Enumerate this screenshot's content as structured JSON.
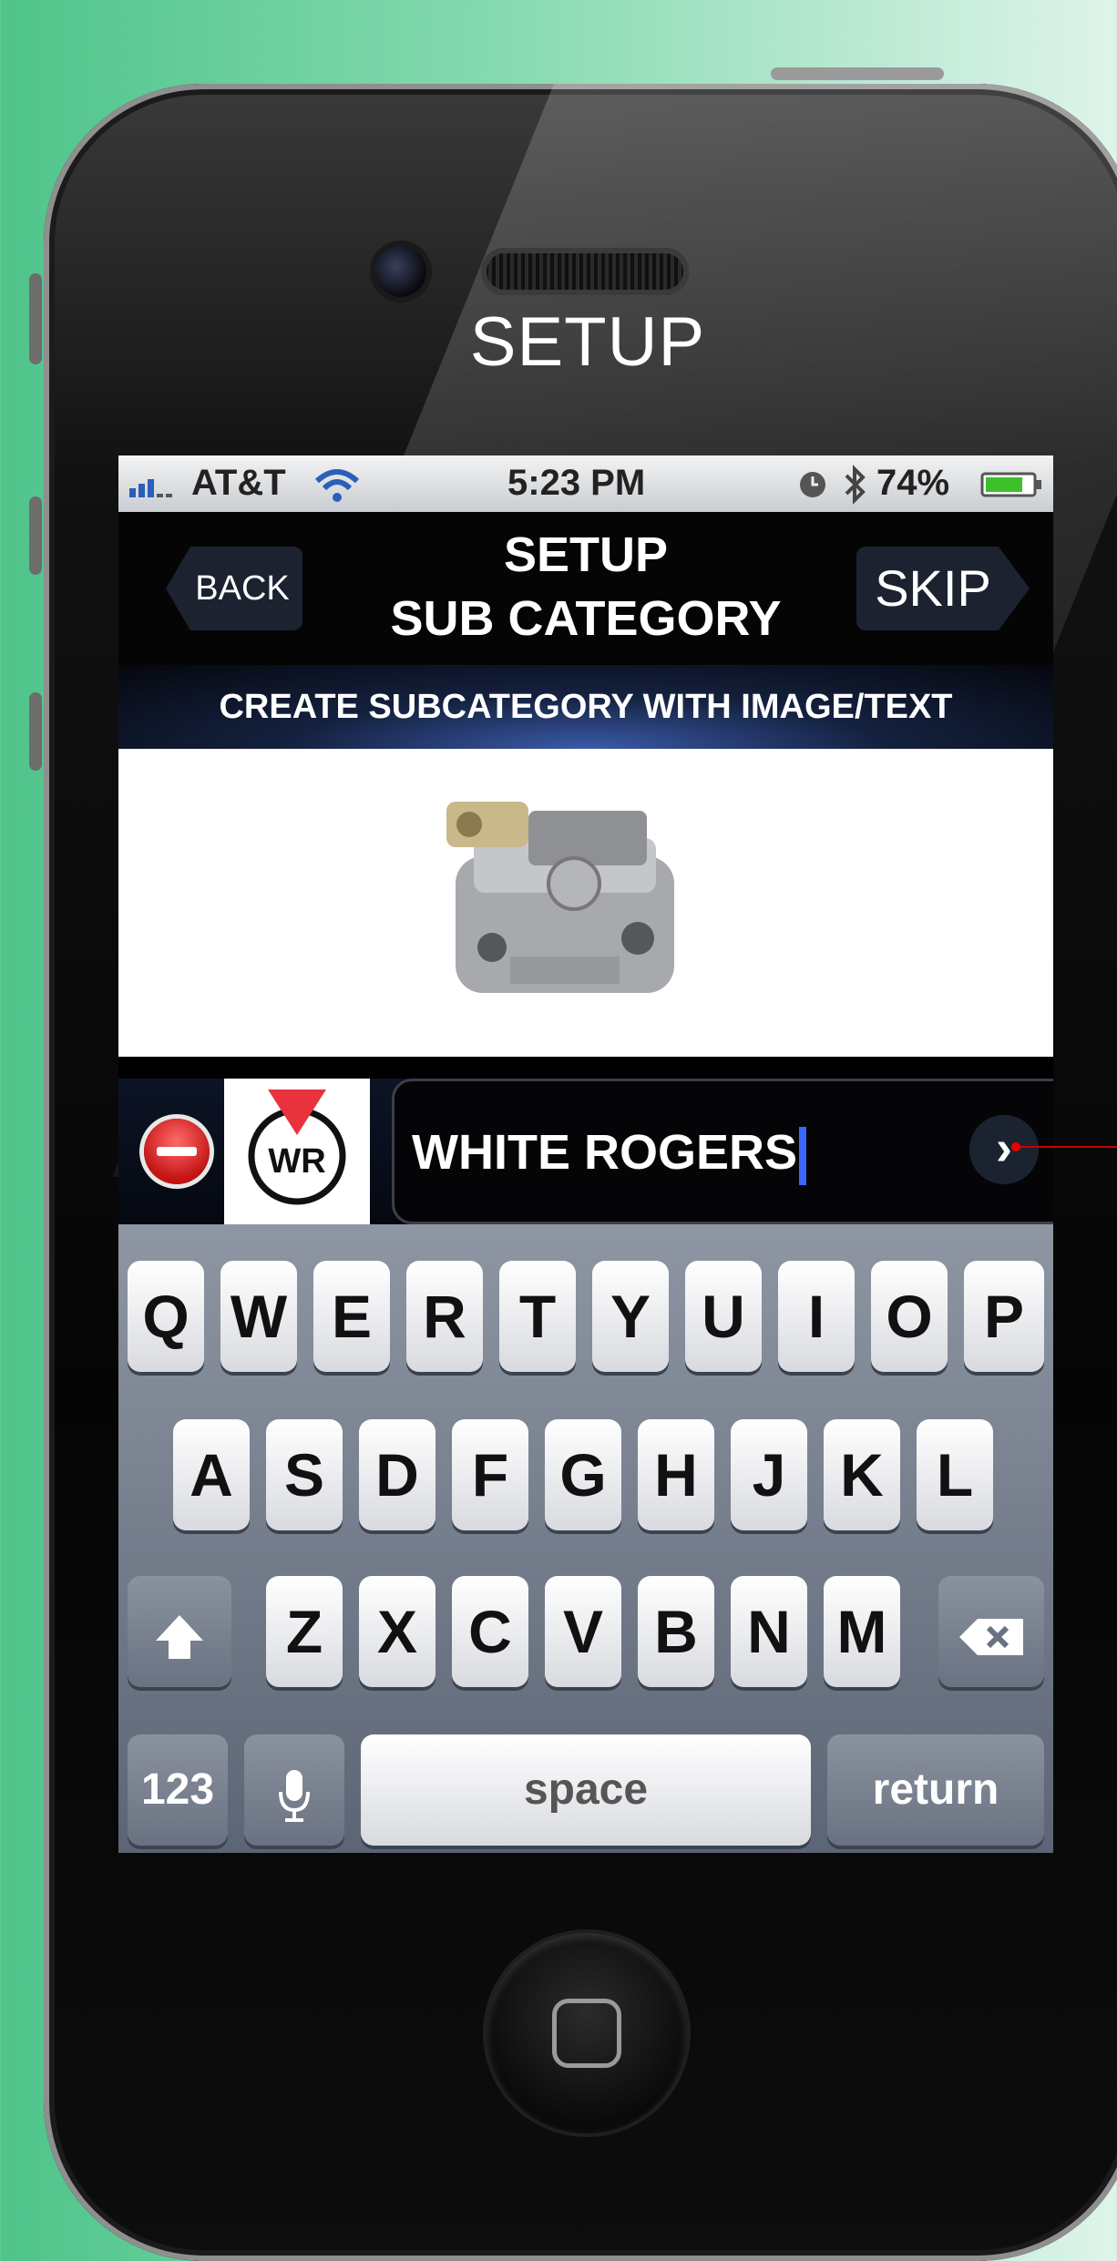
{
  "page": {
    "title": "SETUP"
  },
  "statusbar": {
    "carrier": "AT&T",
    "time": "5:23 PM",
    "battery": "74%"
  },
  "navbar": {
    "back_label": "BACK",
    "title_line1": "SETUP",
    "title_line2": "SUB CATEGORY",
    "skip_label": "SKIP"
  },
  "banner": {
    "text": "CREATE SUBCATEGORY WITH IMAGE/TEXT"
  },
  "input": {
    "value": "WHITE ROGERS",
    "logo_text": "WR"
  },
  "keyboard": {
    "row1": [
      "Q",
      "W",
      "E",
      "R",
      "T",
      "Y",
      "U",
      "I",
      "O",
      "P"
    ],
    "row2": [
      "A",
      "S",
      "D",
      "F",
      "G",
      "H",
      "J",
      "K",
      "L"
    ],
    "row3": [
      "Z",
      "X",
      "C",
      "V",
      "B",
      "N",
      "M"
    ],
    "numbers_label": "123",
    "space_label": "space",
    "return_label": "return"
  },
  "colors": {
    "background_green": "#4fc48a",
    "cursor": "#3a68ff",
    "delete_red": "#d01818"
  }
}
